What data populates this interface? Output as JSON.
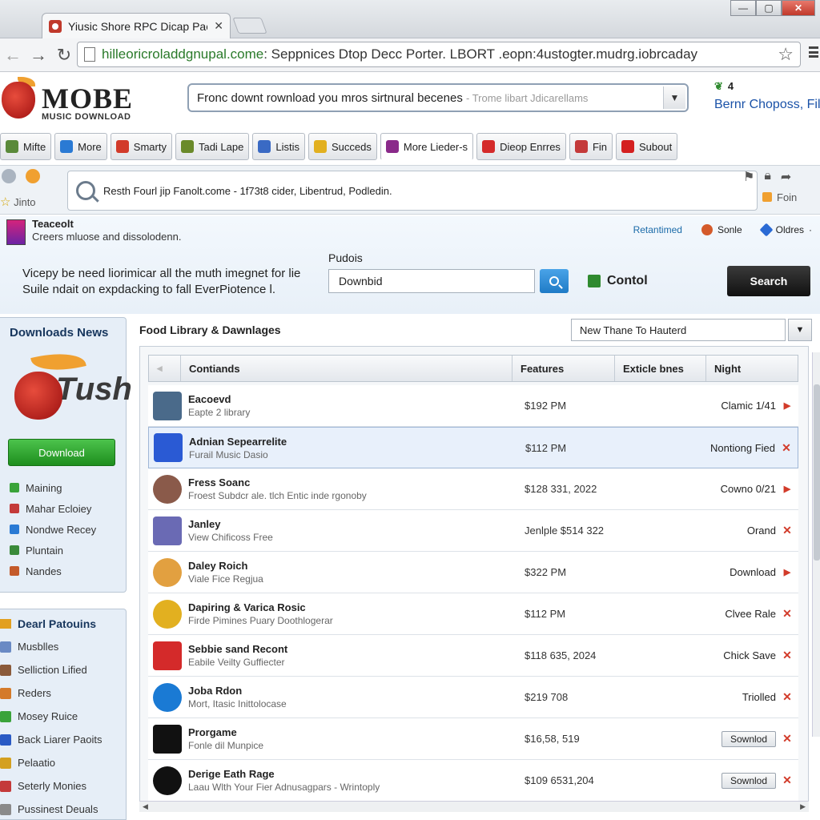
{
  "browser": {
    "tab_title": "Yiusic Shore RPC Dicap Pacert",
    "tab_close": "✕",
    "url_host": "hilleoricroladdgnupal.come",
    "url_rest": ": Seppnices Dtop Decc Porter. LBORT .eopn:4ustogter.mudrg.iobrcaday",
    "window_min": "—",
    "window_max": "▢",
    "window_close": "✕"
  },
  "header": {
    "logo_title": "MOBE",
    "logo_sub": "MUSIC DOWNLOAD",
    "search_value": "Fronc downt rownload you mros sirtnural becenes",
    "search_hint": "- Trome libart Jdicarellams",
    "user_count": "4",
    "user_name": "Bernr Choposs, Fill"
  },
  "toolbar": {
    "items": [
      {
        "label": "Mifte",
        "color": "#5a8a3a"
      },
      {
        "label": "More",
        "color": "#2a7ad4"
      },
      {
        "label": "Smarty",
        "color": "#d23b2a"
      },
      {
        "label": "Tadi Lape",
        "color": "#6a8a2a"
      },
      {
        "label": "Listis",
        "color": "#3a6ac4"
      },
      {
        "label": "Succeds",
        "color": "#e2b020"
      },
      {
        "label": "More Lieder-s",
        "color": "#8a2a8a"
      },
      {
        "label": "Dieop Enrres",
        "color": "#d42a2a"
      },
      {
        "label": "Fin",
        "color": "#c43a3a"
      },
      {
        "label": "Subout",
        "color": "#d42020"
      }
    ]
  },
  "info_strip": {
    "left_label": "Jinto",
    "message": "Resth Fourl jip Fanolt.come - 1f73t8 cider, Libentrud, Podledin.",
    "right_label": "Foin"
  },
  "promo": {
    "teaser_title": "Teaceolt",
    "teaser_sub": "Creers mluose and dissolodenn.",
    "link_1": "Retantimed",
    "link_2": "Sonle",
    "link_3": "Oldres",
    "link_3_caret": "·",
    "text_line_1": "Vicepy be need liorimicar all the muth imegnet for lie",
    "text_line_2": "Suile ndait on expdacking to fall EverPiotence l.",
    "field_label": "Pudois",
    "field_value": "Downbid",
    "control_label": "Contol",
    "search_button": "Search"
  },
  "sidebar": {
    "title": "Downloads News",
    "logo_word": "Tush",
    "download_button": "Download",
    "items": [
      {
        "label": "Maining",
        "color": "#3aa33a"
      },
      {
        "label": "Mahar Ecloiey",
        "color": "#c43a3a"
      },
      {
        "label": "Nondwe Recey",
        "color": "#2a7ad4"
      },
      {
        "label": "Pluntain",
        "color": "#3a8a3a"
      },
      {
        "label": "Nandes",
        "color": "#c45a2a"
      }
    ]
  },
  "sidebar2": {
    "title": "Dearl Patouins",
    "items": [
      {
        "label": "Musblles",
        "color": "#6a8ac4"
      },
      {
        "label": "Selliction Lified",
        "color": "#8a5a3a"
      },
      {
        "label": "Reders",
        "color": "#d47a2a"
      },
      {
        "label": "Mosey Ruice",
        "color": "#3aa33a"
      },
      {
        "label": "Back Liarer Paoits",
        "color": "#2a5ac4"
      },
      {
        "label": "Pelaatio",
        "color": "#d4a020"
      },
      {
        "label": "Seterly Monies",
        "color": "#c43a3a"
      },
      {
        "label": "Pussinest Deuals",
        "color": "#8a8a8a"
      }
    ]
  },
  "main": {
    "heading": "Food Library & Dawnlages",
    "sort_value": "New Thane To Hauterd",
    "columns": [
      "Contiands",
      "Features",
      "Exticle bnes",
      "Night"
    ],
    "rows": [
      {
        "title": "Eacoevd",
        "sub": "Eapte 2 library",
        "price": "$192 PM",
        "right": "Clamic 1/41",
        "button": "",
        "mark": "▶",
        "thumb": "#4a6a8a",
        "selected": false
      },
      {
        "title": "Adnian Sepearrelite",
        "sub": "Furail Music Dasio",
        "price": "$112 PM",
        "right": "Nontiong Fied",
        "button": "",
        "mark": "✕",
        "thumb": "#2a5ad4",
        "selected": true
      },
      {
        "title": "Fress Soanc",
        "sub": "Froest Subdcr ale. tlch Entic inde rgonoby",
        "price": "$128 331, 2022",
        "right": "Cowno 0/21",
        "button": "",
        "mark": "▶",
        "thumb": "#8a5a4a",
        "selected": false
      },
      {
        "title": "Janley",
        "sub": "View Chificoss Free",
        "price": "Jenlple $514 322",
        "right": "Orand",
        "button": "",
        "mark": "✕",
        "thumb": "#6a6ab4",
        "selected": false
      },
      {
        "title": "Daley Roich",
        "sub": "Viale Fice Regjua",
        "price": "$322 PM",
        "right": "Download",
        "button": "",
        "mark": "▶",
        "thumb": "#e2a040",
        "selected": false
      },
      {
        "title": "Dapiring & Varica Rosic",
        "sub": "Firde Pimines Puary Doothlogerar",
        "price": "$112 PM",
        "right": "Clvee Rale",
        "button": "",
        "mark": "✕",
        "thumb": "#e2b020",
        "selected": false
      },
      {
        "title": "Sebbie sand Recont",
        "sub": "Eabile Veilty Guffiecter",
        "price": "$118 635, 2024",
        "right": "Chick Save",
        "button": "",
        "mark": "✕",
        "thumb": "#d42a2a",
        "selected": false
      },
      {
        "title": "Joba Rdon",
        "sub": "Mort, Itasic Inittolocase",
        "price": "$219 708",
        "right": "Triolled",
        "button": "",
        "mark": "✕",
        "thumb": "#1a7ad4",
        "selected": false
      },
      {
        "title": "Prorgame",
        "sub": "Fonle dil Munpice",
        "price": "$16,58, 519",
        "right": "",
        "button": "Sownlod",
        "mark": "✕",
        "thumb": "#111111",
        "selected": false
      },
      {
        "title": "Derige Eath Rage",
        "sub": "Laau Wlth Your Fier Adnusagpars - Wrintoply",
        "price": "$109 6531,204",
        "right": "",
        "button": "Sownlod",
        "mark": "✕",
        "thumb": "#111111",
        "selected": false
      }
    ]
  }
}
